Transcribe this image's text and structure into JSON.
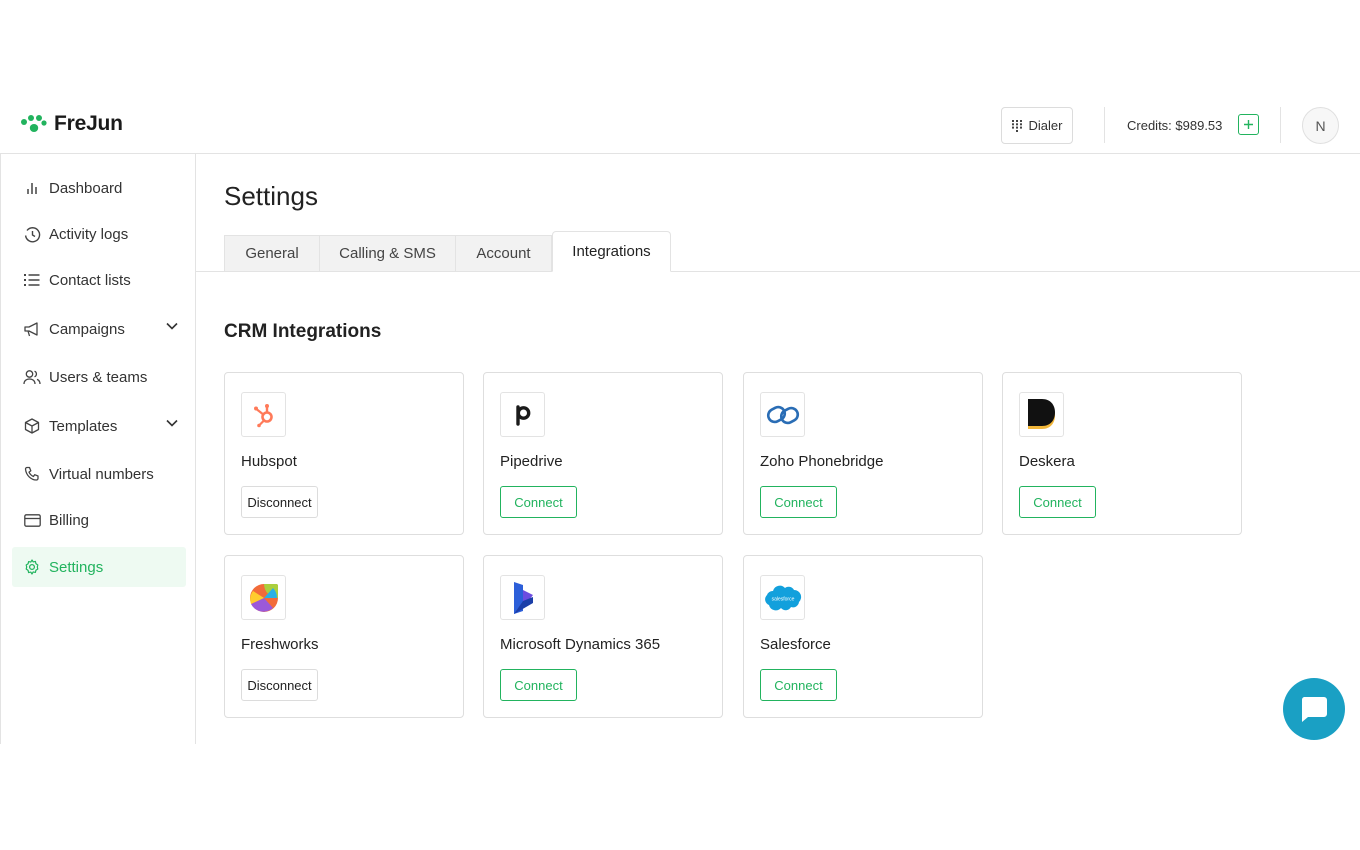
{
  "header": {
    "brand": "FreJun",
    "dialer_label": "Dialer",
    "credits_label": "Credits: $989.53",
    "avatar_initial": "N"
  },
  "sidebar": {
    "items": [
      {
        "label": "Dashboard",
        "icon": "bar-chart-icon"
      },
      {
        "label": "Activity logs",
        "icon": "clock-history-icon"
      },
      {
        "label": "Contact lists",
        "icon": "list-icon"
      },
      {
        "label": "Campaigns",
        "icon": "megaphone-icon",
        "expandable": true
      },
      {
        "label": "Users & teams",
        "icon": "users-icon"
      },
      {
        "label": "Templates",
        "icon": "box-icon",
        "expandable": true
      },
      {
        "label": "Virtual numbers",
        "icon": "phone-icon"
      },
      {
        "label": "Billing",
        "icon": "credit-card-icon"
      },
      {
        "label": "Settings",
        "icon": "gear-icon",
        "active": true
      }
    ]
  },
  "main": {
    "title": "Settings",
    "tabs": [
      {
        "label": "General"
      },
      {
        "label": "Calling & SMS"
      },
      {
        "label": "Account"
      },
      {
        "label": "Integrations",
        "active": true
      }
    ],
    "section_title": "CRM Integrations",
    "integrations": [
      {
        "name": "Hubspot",
        "action": "Disconnect",
        "logo": "hubspot-logo"
      },
      {
        "name": "Pipedrive",
        "action": "Connect",
        "logo": "pipedrive-logo"
      },
      {
        "name": "Zoho Phonebridge",
        "action": "Connect",
        "logo": "zoho-logo"
      },
      {
        "name": "Deskera",
        "action": "Connect",
        "logo": "deskera-logo"
      },
      {
        "name": "Freshworks",
        "action": "Disconnect",
        "logo": "freshworks-logo"
      },
      {
        "name": "Microsoft Dynamics 365",
        "action": "Connect",
        "logo": "dynamics-logo"
      },
      {
        "name": "Salesforce",
        "action": "Connect",
        "logo": "salesforce-logo",
        "logo_text": "salesforce"
      }
    ]
  },
  "colors": {
    "accent": "#22b35e",
    "active_bg": "#eefaf2",
    "chat": "#1aa0c4"
  }
}
